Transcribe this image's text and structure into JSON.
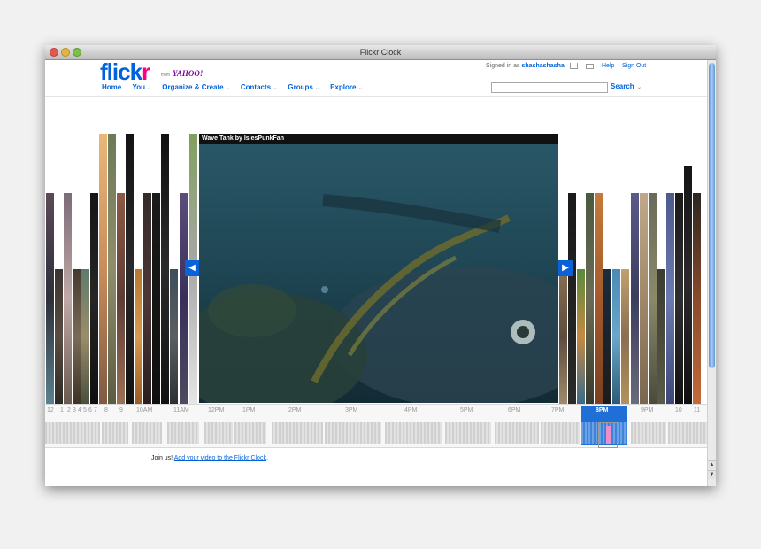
{
  "window": {
    "title": "Flickr Clock"
  },
  "header": {
    "logo_part1": "flick",
    "logo_part2": "r",
    "from_label": "from",
    "yahoo_label": "YAHOO!",
    "nav": [
      {
        "label": "Home",
        "has_menu": false
      },
      {
        "label": "You",
        "has_menu": true
      },
      {
        "label": "Organize & Create",
        "has_menu": true
      },
      {
        "label": "Contacts",
        "has_menu": true
      },
      {
        "label": "Groups",
        "has_menu": true
      },
      {
        "label": "Explore",
        "has_menu": true
      }
    ],
    "signed_in_prefix": "Signed in as",
    "username": "shashashasha",
    "help": "Help",
    "signout": "Sign Out",
    "search_button": "Search",
    "search_value": ""
  },
  "player": {
    "title": "Wave Tank by IslesPunkFan",
    "prev_icon": "left-arrow-icon",
    "next_icon": "right-arrow-icon"
  },
  "timeline": {
    "labels": [
      "12",
      "1",
      "2",
      "3",
      "4",
      "5",
      "6",
      "7",
      "8",
      "9",
      "10AM",
      "11AM",
      "12PM",
      "1PM",
      "2PM",
      "3PM",
      "4PM",
      "5PM",
      "6PM",
      "7PM",
      "8PM",
      "9PM",
      "10",
      "11"
    ],
    "active": "8PM"
  },
  "footer": {
    "join_text": "Join us!",
    "join_link": "Add your video to the Flickr Clock"
  },
  "colors": {
    "flickr_blue": "#0063dc",
    "flickr_pink": "#ff0084",
    "timeline_active": "#1f6fd6"
  }
}
